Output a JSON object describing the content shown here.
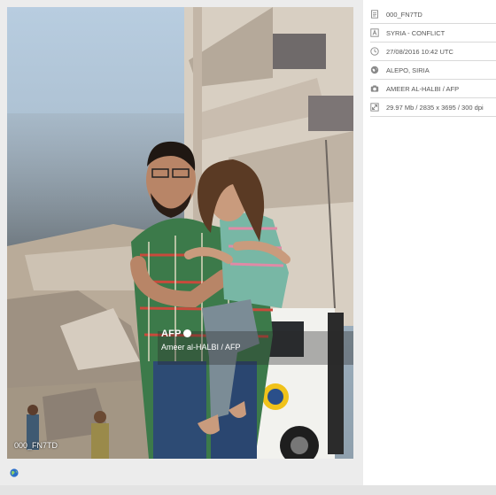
{
  "photo": {
    "agency_logo": "AFP",
    "credit_overlay": "Ameer al-HALBI / AFP",
    "photo_id_overlay": "000_FN7TD"
  },
  "metadata": [
    {
      "icon": "document-icon",
      "text": "000_FN7TD"
    },
    {
      "icon": "category-icon",
      "text": "SYRIA - CONFLICT"
    },
    {
      "icon": "clock-icon",
      "text": "27/08/2016 10:42 UTC"
    },
    {
      "icon": "location-icon",
      "text": "ALEPO, SIRIA"
    },
    {
      "icon": "camera-icon",
      "text": "AMEER AL-HALBI / AFP"
    },
    {
      "icon": "resize-icon",
      "text": "29.97 Mb / 2835 x 3695 / 300 dpi"
    }
  ],
  "bottom_bar": {
    "icon": "globe-icon"
  },
  "colors": {
    "accent": "#2a6fc9",
    "panel_bg": "#ffffff",
    "divider": "#d9d9d9",
    "text": "#555555"
  }
}
